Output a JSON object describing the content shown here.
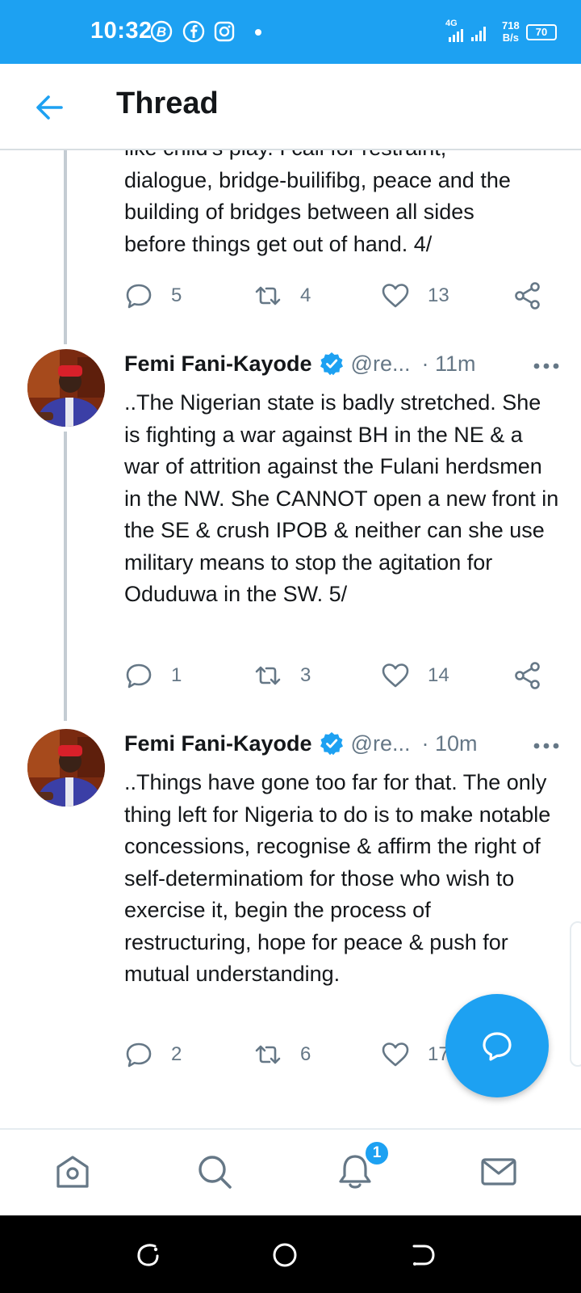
{
  "status_bar": {
    "time": "10:32",
    "network": "4G",
    "speed_value": "718",
    "speed_unit": "B/s",
    "battery": "70",
    "icons": [
      "b-badge-icon",
      "facebook-icon",
      "instagram-icon",
      "signal-icon",
      "battery-icon"
    ]
  },
  "header": {
    "title": "Thread",
    "back_icon": "arrow-left-icon"
  },
  "tweets": [
    {
      "text_lines": [
        "like child's play. I call for restraint,",
        "dialogue, bridge-builifibg, peace and the",
        "building of bridges between all sides",
        "before things get out of hand. 4/"
      ],
      "replies": "5",
      "retweets": "4",
      "likes": "13"
    },
    {
      "author": "Femi Fani-Kayode",
      "handle": "@re...",
      "time": "· 11m",
      "text": "..The Nigerian state is badly stretched. She is fighting a war against BH in the NE & a war of attrition against the Fulani herdsmen in the NW. She CANNOT open a new front in the SE & crush IPOB & neither can she use military means to stop the agitation for Oduduwa in the SW. 5/",
      "replies": "1",
      "retweets": "3",
      "likes": "14"
    },
    {
      "author": "Femi Fani-Kayode",
      "handle": "@re...",
      "time": "· 10m",
      "text": "..Things have gone too far for that. The only thing left for Nigeria to do is to make notable concessions, recognise & affirm the right of self-determinatiom for those who wish to exercise it, begin the process of restructuring, hope for peace & push for mutual understanding.",
      "replies": "2",
      "retweets": "6",
      "likes": "17"
    }
  ],
  "bottom_nav": {
    "items": [
      "home-icon",
      "search-icon",
      "notifications-icon",
      "messages-icon"
    ],
    "notification_count": "1"
  },
  "colors": {
    "accent": "#1da1f2",
    "text": "#14171a",
    "muted": "#657786"
  }
}
